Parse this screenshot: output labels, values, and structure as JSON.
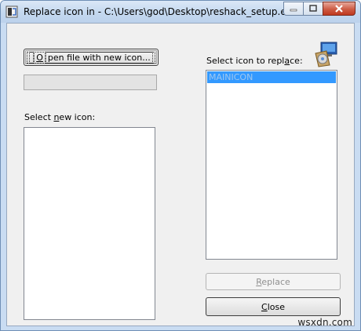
{
  "window": {
    "title": "Replace icon in - C:\\Users\\god\\Desktop\\reshack_setup.exe"
  },
  "buttons": {
    "open_file": {
      "prefix": "",
      "mnemonic": "O",
      "rest": "pen file with new icon..."
    },
    "replace": {
      "prefix": "",
      "mnemonic": "R",
      "rest": "eplace"
    },
    "close": {
      "prefix": "",
      "mnemonic": "C",
      "rest": "lose"
    }
  },
  "labels": {
    "select_new": {
      "prefix": "Select ",
      "mnemonic": "n",
      "rest": "ew icon:"
    },
    "select_replace": {
      "prefix": "Select icon to repl",
      "mnemonic": "a",
      "rest": "ce:"
    }
  },
  "file_path_field": {
    "value": ""
  },
  "replace_list": {
    "items": [
      {
        "label": "MAINICON",
        "selected": true
      }
    ]
  },
  "icons": {
    "app": "resource-hacker-icon",
    "install": "installer-package-icon",
    "minimize": "minimize-icon",
    "maximize": "maximize-icon",
    "close": "close-icon"
  },
  "watermark": "wsxdn.com",
  "colors": {
    "selection": "#3399ff",
    "close_caption": "#c0391f",
    "title_bar": "#c4d8ef"
  }
}
